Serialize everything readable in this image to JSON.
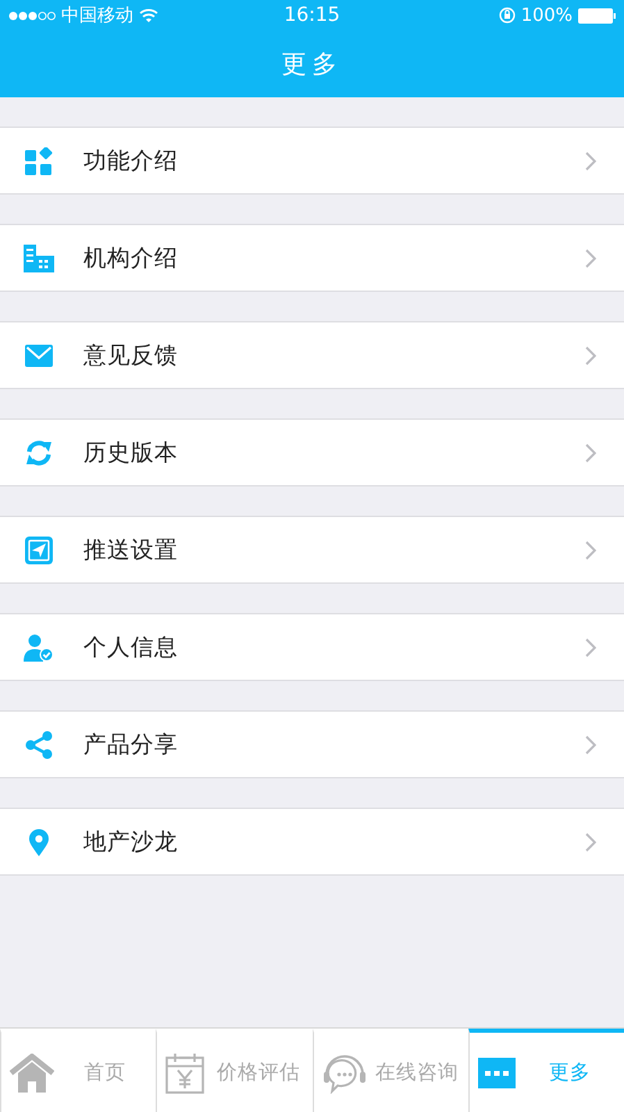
{
  "status_bar": {
    "carrier": "中国移动",
    "time": "16:15",
    "battery": "100%"
  },
  "nav_bar": {
    "title": "更多"
  },
  "menu": [
    {
      "label": "功能介绍"
    },
    {
      "label": "机构介绍"
    },
    {
      "label": "意见反馈"
    },
    {
      "label": "历史版本"
    },
    {
      "label": "推送设置"
    },
    {
      "label": "个人信息"
    },
    {
      "label": "产品分享"
    },
    {
      "label": "地产沙龙"
    }
  ],
  "tab_bar": [
    {
      "label": "首页",
      "selected": false
    },
    {
      "label": "价格评估",
      "selected": false
    },
    {
      "label": "在线咨询",
      "selected": false
    },
    {
      "label": "更多",
      "selected": true
    }
  ]
}
